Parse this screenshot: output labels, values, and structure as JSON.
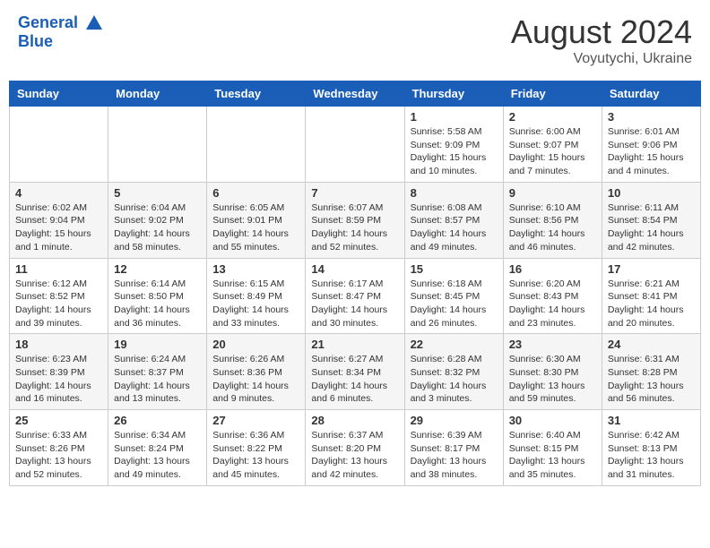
{
  "header": {
    "logo_line1": "General",
    "logo_line2": "Blue",
    "month": "August 2024",
    "location": "Voyutychi, Ukraine"
  },
  "weekdays": [
    "Sunday",
    "Monday",
    "Tuesday",
    "Wednesday",
    "Thursday",
    "Friday",
    "Saturday"
  ],
  "weeks": [
    [
      null,
      null,
      null,
      null,
      {
        "day": "1",
        "sunrise": "Sunrise: 5:58 AM",
        "sunset": "Sunset: 9:09 PM",
        "daylight": "Daylight: 15 hours and 10 minutes."
      },
      {
        "day": "2",
        "sunrise": "Sunrise: 6:00 AM",
        "sunset": "Sunset: 9:07 PM",
        "daylight": "Daylight: 15 hours and 7 minutes."
      },
      {
        "day": "3",
        "sunrise": "Sunrise: 6:01 AM",
        "sunset": "Sunset: 9:06 PM",
        "daylight": "Daylight: 15 hours and 4 minutes."
      }
    ],
    [
      {
        "day": "4",
        "sunrise": "Sunrise: 6:02 AM",
        "sunset": "Sunset: 9:04 PM",
        "daylight": "Daylight: 15 hours and 1 minute."
      },
      {
        "day": "5",
        "sunrise": "Sunrise: 6:04 AM",
        "sunset": "Sunset: 9:02 PM",
        "daylight": "Daylight: 14 hours and 58 minutes."
      },
      {
        "day": "6",
        "sunrise": "Sunrise: 6:05 AM",
        "sunset": "Sunset: 9:01 PM",
        "daylight": "Daylight: 14 hours and 55 minutes."
      },
      {
        "day": "7",
        "sunrise": "Sunrise: 6:07 AM",
        "sunset": "Sunset: 8:59 PM",
        "daylight": "Daylight: 14 hours and 52 minutes."
      },
      {
        "day": "8",
        "sunrise": "Sunrise: 6:08 AM",
        "sunset": "Sunset: 8:57 PM",
        "daylight": "Daylight: 14 hours and 49 minutes."
      },
      {
        "day": "9",
        "sunrise": "Sunrise: 6:10 AM",
        "sunset": "Sunset: 8:56 PM",
        "daylight": "Daylight: 14 hours and 46 minutes."
      },
      {
        "day": "10",
        "sunrise": "Sunrise: 6:11 AM",
        "sunset": "Sunset: 8:54 PM",
        "daylight": "Daylight: 14 hours and 42 minutes."
      }
    ],
    [
      {
        "day": "11",
        "sunrise": "Sunrise: 6:12 AM",
        "sunset": "Sunset: 8:52 PM",
        "daylight": "Daylight: 14 hours and 39 minutes."
      },
      {
        "day": "12",
        "sunrise": "Sunrise: 6:14 AM",
        "sunset": "Sunset: 8:50 PM",
        "daylight": "Daylight: 14 hours and 36 minutes."
      },
      {
        "day": "13",
        "sunrise": "Sunrise: 6:15 AM",
        "sunset": "Sunset: 8:49 PM",
        "daylight": "Daylight: 14 hours and 33 minutes."
      },
      {
        "day": "14",
        "sunrise": "Sunrise: 6:17 AM",
        "sunset": "Sunset: 8:47 PM",
        "daylight": "Daylight: 14 hours and 30 minutes."
      },
      {
        "day": "15",
        "sunrise": "Sunrise: 6:18 AM",
        "sunset": "Sunset: 8:45 PM",
        "daylight": "Daylight: 14 hours and 26 minutes."
      },
      {
        "day": "16",
        "sunrise": "Sunrise: 6:20 AM",
        "sunset": "Sunset: 8:43 PM",
        "daylight": "Daylight: 14 hours and 23 minutes."
      },
      {
        "day": "17",
        "sunrise": "Sunrise: 6:21 AM",
        "sunset": "Sunset: 8:41 PM",
        "daylight": "Daylight: 14 hours and 20 minutes."
      }
    ],
    [
      {
        "day": "18",
        "sunrise": "Sunrise: 6:23 AM",
        "sunset": "Sunset: 8:39 PM",
        "daylight": "Daylight: 14 hours and 16 minutes."
      },
      {
        "day": "19",
        "sunrise": "Sunrise: 6:24 AM",
        "sunset": "Sunset: 8:37 PM",
        "daylight": "Daylight: 14 hours and 13 minutes."
      },
      {
        "day": "20",
        "sunrise": "Sunrise: 6:26 AM",
        "sunset": "Sunset: 8:36 PM",
        "daylight": "Daylight: 14 hours and 9 minutes."
      },
      {
        "day": "21",
        "sunrise": "Sunrise: 6:27 AM",
        "sunset": "Sunset: 8:34 PM",
        "daylight": "Daylight: 14 hours and 6 minutes."
      },
      {
        "day": "22",
        "sunrise": "Sunrise: 6:28 AM",
        "sunset": "Sunset: 8:32 PM",
        "daylight": "Daylight: 14 hours and 3 minutes."
      },
      {
        "day": "23",
        "sunrise": "Sunrise: 6:30 AM",
        "sunset": "Sunset: 8:30 PM",
        "daylight": "Daylight: 13 hours and 59 minutes."
      },
      {
        "day": "24",
        "sunrise": "Sunrise: 6:31 AM",
        "sunset": "Sunset: 8:28 PM",
        "daylight": "Daylight: 13 hours and 56 minutes."
      }
    ],
    [
      {
        "day": "25",
        "sunrise": "Sunrise: 6:33 AM",
        "sunset": "Sunset: 8:26 PM",
        "daylight": "Daylight: 13 hours and 52 minutes."
      },
      {
        "day": "26",
        "sunrise": "Sunrise: 6:34 AM",
        "sunset": "Sunset: 8:24 PM",
        "daylight": "Daylight: 13 hours and 49 minutes."
      },
      {
        "day": "27",
        "sunrise": "Sunrise: 6:36 AM",
        "sunset": "Sunset: 8:22 PM",
        "daylight": "Daylight: 13 hours and 45 minutes."
      },
      {
        "day": "28",
        "sunrise": "Sunrise: 6:37 AM",
        "sunset": "Sunset: 8:20 PM",
        "daylight": "Daylight: 13 hours and 42 minutes."
      },
      {
        "day": "29",
        "sunrise": "Sunrise: 6:39 AM",
        "sunset": "Sunset: 8:17 PM",
        "daylight": "Daylight: 13 hours and 38 minutes."
      },
      {
        "day": "30",
        "sunrise": "Sunrise: 6:40 AM",
        "sunset": "Sunset: 8:15 PM",
        "daylight": "Daylight: 13 hours and 35 minutes."
      },
      {
        "day": "31",
        "sunrise": "Sunrise: 6:42 AM",
        "sunset": "Sunset: 8:13 PM",
        "daylight": "Daylight: 13 hours and 31 minutes."
      }
    ]
  ]
}
